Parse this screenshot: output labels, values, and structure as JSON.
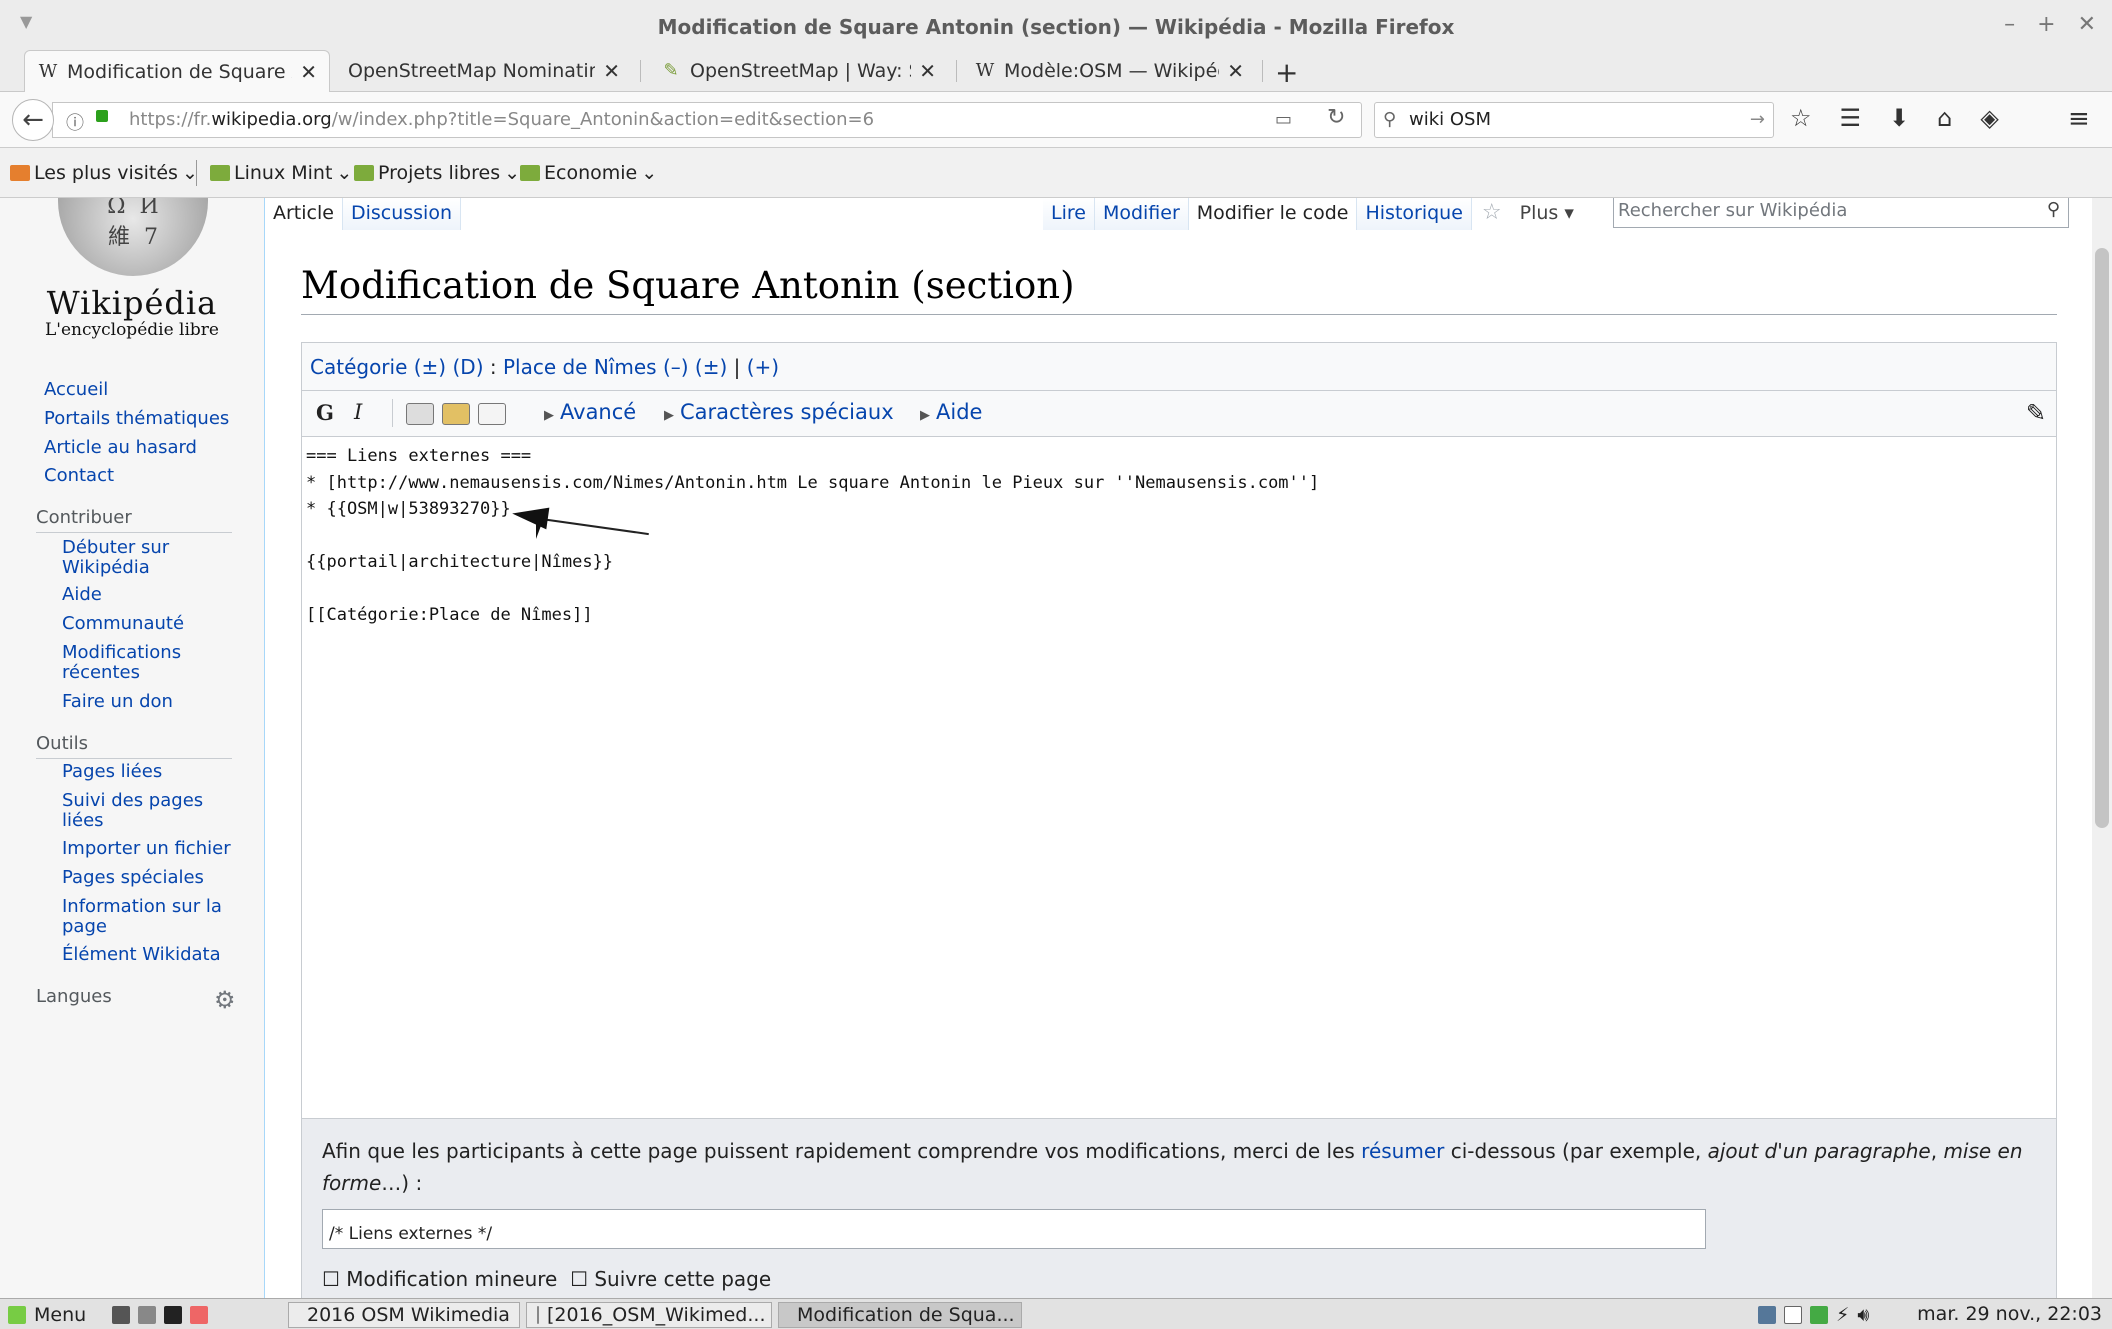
{
  "window": {
    "title": "Modification de Square Antonin (section) — Wikipédia - Mozilla Firefox"
  },
  "tabs": [
    {
      "label": "Modification de Square A...",
      "icon": "wikipedia-icon"
    },
    {
      "label": "OpenStreetMap Nominatim: ...",
      "icon": "none"
    },
    {
      "label": "OpenStreetMap | Way: S...",
      "icon": "osm-icon"
    },
    {
      "label": "Modèle:OSM — Wikipédia",
      "icon": "wikipedia-icon"
    }
  ],
  "navbar": {
    "url_prefix": "https://fr.",
    "url_domain": "wikipedia.org",
    "url_rest": "/w/index.php?title=Square_Antonin&action=edit&section=6",
    "search_value": "wiki OSM"
  },
  "bookmarks": [
    "Les plus visités",
    "Linux Mint",
    "Projets libres",
    "Economie"
  ],
  "wiki": {
    "brand": "Wikipédia",
    "tagline": "L'encyclopédie libre",
    "nav": [
      "Accueil",
      "Portails thématiques",
      "Article au hasard",
      "Contact"
    ],
    "contribute_head": "Contribuer",
    "contribute": [
      "Débuter sur Wikipédia",
      "Aide",
      "Communauté",
      "Modifications récentes",
      "Faire un don"
    ],
    "tools_head": "Outils",
    "tools": [
      "Pages liées",
      "Suivi des pages liées",
      "Importer un fichier",
      "Pages spéciales",
      "Information sur la page",
      "Élément Wikidata"
    ],
    "lang_head": "Langues",
    "left_tabs": [
      "Article",
      "Discussion"
    ],
    "right_tabs": [
      "Lire",
      "Modifier",
      "Modifier le code",
      "Historique"
    ],
    "more": "Plus",
    "search_placeholder": "Rechercher sur Wikipédia",
    "heading": "Modification de Square Antonin (section)",
    "catbar": {
      "cat": "Catégorie",
      "pm1": "(±)",
      "d": "(D)",
      "colon": " : ",
      "place": "Place de Nîmes",
      "minus": "(–)",
      "pm2": "(±)",
      "pipe": " | ",
      "plus": "(+)"
    },
    "toolbar": {
      "bold": "G",
      "italic": "I",
      "advanced": "Avancé",
      "special": "Caractères spéciaux",
      "help": "Aide"
    },
    "code_lines": [
      "=== Liens externes ===",
      "* [http://www.nemausensis.com/Nimes/Antonin.htm Le square Antonin le Pieux sur ''Nemausensis.com'']",
      "* {{OSM|w|53893270}}",
      "",
      "{{portail|architecture|Nîmes}}",
      "",
      "[[Catégorie:Place de Nîmes]]"
    ],
    "summary": {
      "text1": "Afin que les participants à cette page puissent rapidement comprendre vos modifications, merci de les ",
      "link": "résumer",
      "text2": " ci-dessous (par exemple, ",
      "italic1": "ajout d'un paragraphe",
      "text3": ", ",
      "italic2": "mise en forme",
      "text4": "…) :",
      "input_value": "/* Liens externes */",
      "minor": "Modification mineure",
      "watch": "Suivre cette page"
    }
  },
  "taskbar": {
    "menu": "Menu",
    "windows": [
      "2016 OSM Wikimedia",
      "[2016_OSM_Wikimed...",
      "Modification de Squa..."
    ],
    "clock": "mar. 29 nov., 22:03"
  }
}
